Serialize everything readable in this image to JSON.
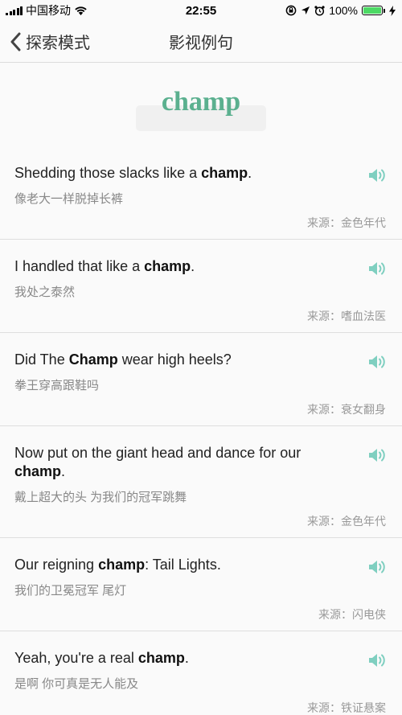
{
  "status_bar": {
    "carrier": "中国移动",
    "time": "22:55",
    "battery_pct": "100%"
  },
  "nav": {
    "back_label": "探索模式",
    "title": "影视例句"
  },
  "headword": "champ",
  "colors": {
    "accent": "#5bb08f",
    "speaker": "#7fcfc0"
  },
  "sentences": [
    {
      "en_before": "Shedding those slacks like a ",
      "en_bold": "champ",
      "en_after": ".",
      "zh": "像老大一样脱掉长裤",
      "source": "来源：金色年代"
    },
    {
      "en_before": "I handled that like a ",
      "en_bold": "champ",
      "en_after": ".",
      "zh": "我处之泰然",
      "source": "来源：嗜血法医"
    },
    {
      "en_before": "Did The ",
      "en_bold": "Champ",
      "en_after": " wear high heels?",
      "zh": "拳王穿高跟鞋吗",
      "source": "来源：衰女翻身"
    },
    {
      "en_before": "Now put on the giant head and dance for our ",
      "en_bold": "champ",
      "en_after": ".",
      "zh": "戴上超大的头  为我们的冠军跳舞",
      "source": "来源：金色年代"
    },
    {
      "en_before": "Our reigning ",
      "en_bold": "champ",
      "en_after": ": Tail Lights.",
      "zh": "我们的卫冕冠军  尾灯",
      "source": "来源：闪电侠"
    },
    {
      "en_before": "Yeah, you're a real ",
      "en_bold": "champ",
      "en_after": ".",
      "zh": "是啊  你可真是无人能及",
      "source": "来源：铁证悬案"
    }
  ]
}
